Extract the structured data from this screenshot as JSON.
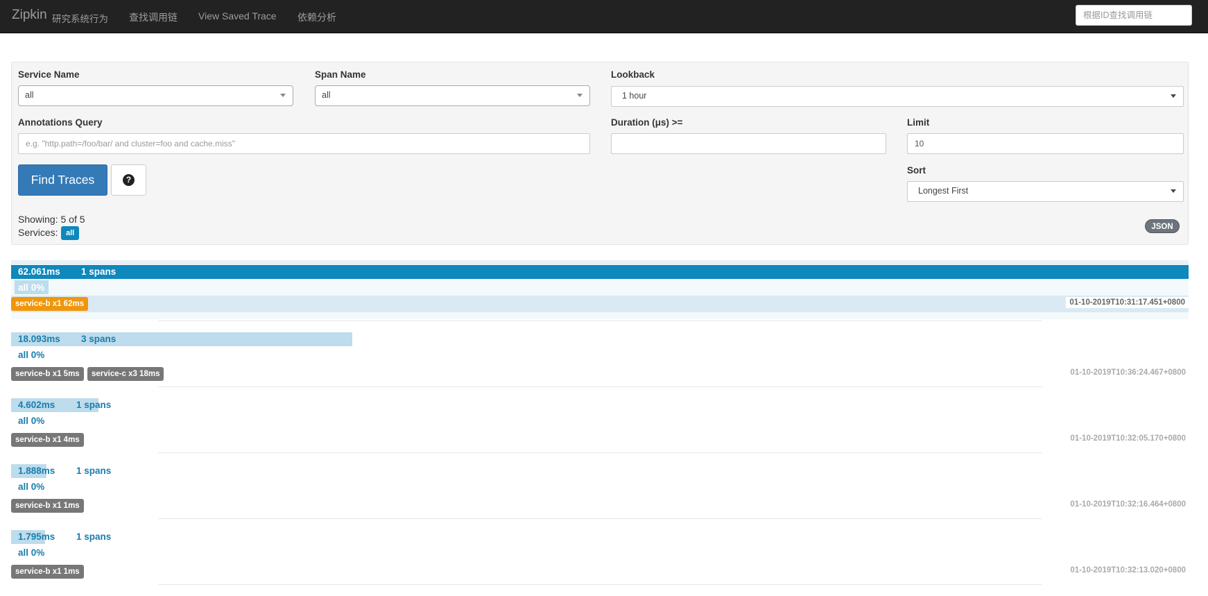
{
  "navbar": {
    "brand": "Zipkin",
    "brand_sub": "研究系统行为",
    "links": [
      "查找调用链",
      "View Saved Trace",
      "依赖分析"
    ],
    "search_placeholder": "根据ID查找调用链"
  },
  "search": {
    "service_label": "Service Name",
    "service_value": "all",
    "span_label": "Span Name",
    "span_value": "all",
    "lookback_label": "Lookback",
    "lookback_value": "1 hour",
    "annotations_label": "Annotations Query",
    "annotations_placeholder": "e.g. \"http.path=/foo/bar/ and cluster=foo and cache.miss\"",
    "duration_label": "Duration (μs) >=",
    "duration_value": "",
    "limit_label": "Limit",
    "limit_value": "10",
    "sort_label": "Sort",
    "sort_value": "Longest First",
    "find_label": "Find Traces",
    "help_icon": "?",
    "showing": "Showing: 5 of 5",
    "services_label": "Services:",
    "services_badge": "all",
    "json_label": "JSON"
  },
  "traces": [
    {
      "duration": "62.061ms",
      "spans": "1 spans",
      "percent": "all 0%",
      "bar_fraction": 1.0,
      "services": [
        {
          "label": "service-b x1 62ms",
          "color": "#f0960b"
        }
      ],
      "timestamp": "01-10-2019T10:31:17.451+0800",
      "selected": true
    },
    {
      "duration": "18.093ms",
      "spans": "3 spans",
      "percent": "all 0%",
      "bar_fraction": 0.29,
      "services": [
        {
          "label": "service-b x1 5ms",
          "color": "#777777"
        },
        {
          "label": "service-c x3 18ms",
          "color": "#777777"
        }
      ],
      "timestamp": "01-10-2019T10:36:24.467+0800",
      "selected": false
    },
    {
      "duration": "4.602ms",
      "spans": "1 spans",
      "percent": "all 0%",
      "bar_fraction": 0.074,
      "services": [
        {
          "label": "service-b x1 4ms",
          "color": "#777777"
        }
      ],
      "timestamp": "01-10-2019T10:32:05.170+0800",
      "selected": false
    },
    {
      "duration": "1.888ms",
      "spans": "1 spans",
      "percent": "all 0%",
      "bar_fraction": 0.03,
      "services": [
        {
          "label": "service-b x1 1ms",
          "color": "#777777"
        }
      ],
      "timestamp": "01-10-2019T10:32:16.464+0800",
      "selected": false
    },
    {
      "duration": "1.795ms",
      "spans": "1 spans",
      "percent": "all 0%",
      "bar_fraction": 0.029,
      "services": [
        {
          "label": "service-b x1 1ms",
          "color": "#777777"
        }
      ],
      "timestamp": "01-10-2019T10:32:13.020+0800",
      "selected": false
    }
  ]
}
